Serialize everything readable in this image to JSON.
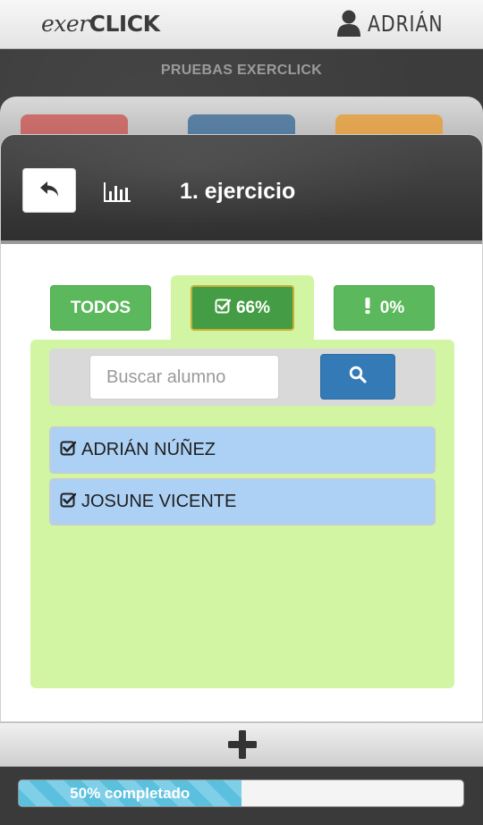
{
  "header": {
    "logo_part1": "exer",
    "logo_part2": "CLICK",
    "user_name": "ADRIÁN",
    "user_icon": "user-icon"
  },
  "board": {
    "title": "PRUEBAS EXERCLICK",
    "tile_colors": [
      "#c9302c",
      "#286090",
      "#ec971f"
    ]
  },
  "modal": {
    "title": "1. ejercicio",
    "back_icon": "reply-arrow-icon",
    "stats_icon": "bar-chart-icon",
    "tabs": [
      {
        "label": "TODOS",
        "icon": ""
      },
      {
        "label": "66%",
        "icon": "check-square-icon",
        "active": true
      },
      {
        "label": "0%",
        "icon": "exclamation-icon"
      }
    ],
    "search": {
      "placeholder": "Buscar alumno",
      "button_icon": "search-icon"
    },
    "students": [
      {
        "name": "ADRIÁN NÚÑEZ",
        "icon": "check-square-icon"
      },
      {
        "name": "JOSUNE VICENTE",
        "icon": "check-square-icon"
      }
    ]
  },
  "footer": {
    "add_icon": "plus-icon",
    "progress_fraction": 0.5,
    "progress_label": "50% completado"
  },
  "colors": {
    "success": "#5cb85c",
    "primary": "#337ab7",
    "info": "#5bc0de",
    "panel": "#d2f5a4",
    "student_row": "#acd1f4"
  }
}
